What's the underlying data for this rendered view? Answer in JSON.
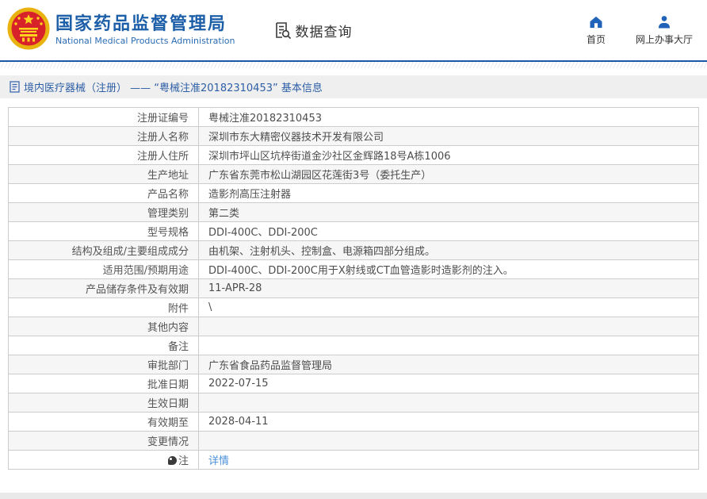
{
  "header": {
    "org_name_zh": "国家药品监督管理局",
    "org_name_en": "National Medical Products Administration",
    "nav_data_query": "数据查询",
    "nav_home": "首页",
    "nav_service_hall": "网上办事大厅",
    "icons": {
      "emblem": "china-national-emblem",
      "data_query": "document-search-icon",
      "home": "home-icon",
      "service_hall": "person-icon"
    }
  },
  "page": {
    "title": "境内医疗器械（注册） —— “粤械注准20182310453” 基本信息",
    "title_icon": "document-icon"
  },
  "table": {
    "rows": [
      {
        "label": "注册证编号",
        "value": "粤械注准20182310453"
      },
      {
        "label": "注册人名称",
        "value": "深圳市东大精密仪器技术开发有限公司"
      },
      {
        "label": "注册人住所",
        "value": "深圳市坪山区坑梓街道金沙社区金辉路18号A栋1006"
      },
      {
        "label": "生产地址",
        "value": "广东省东莞市松山湖园区花莲街3号（委托生产）"
      },
      {
        "label": "产品名称",
        "value": "造影剂高压注射器"
      },
      {
        "label": "管理类别",
        "value": "第二类"
      },
      {
        "label": "型号规格",
        "value": "DDI-400C、DDI-200C"
      },
      {
        "label": "结构及组成/主要组成成分",
        "value": "由机架、注射机头、控制盒、电源箱四部分组成。"
      },
      {
        "label": "适用范围/预期用途",
        "value": "DDI-400C、DDI-200C用于X射线或CT血管造影时造影剂的注入。"
      },
      {
        "label": "产品储存条件及有效期",
        "value": "11-APR-28"
      },
      {
        "label": "附件",
        "value": "\\"
      },
      {
        "label": "其他内容",
        "value": ""
      },
      {
        "label": "备注",
        "value": ""
      },
      {
        "label": "审批部门",
        "value": "广东省食品药品监督管理局"
      },
      {
        "label": "批准日期",
        "value": "2022-07-15"
      },
      {
        "label": "生效日期",
        "value": ""
      },
      {
        "label": "有效期至",
        "value": "2028-04-11"
      },
      {
        "label": "变更情况",
        "value": ""
      },
      {
        "label": "注",
        "value": "详情",
        "link": true,
        "icon": "note-pin-icon"
      }
    ]
  },
  "colors": {
    "brand_blue": "#1c5fa8",
    "icon_blue": "#1f62b8",
    "link_blue": "#4a90d9",
    "title_bar_bg": "#efefef",
    "row_alt_bg": "#f6f6f6",
    "border": "#cccccc",
    "emblem_red": "#d8222a",
    "emblem_gold": "#e8b30e"
  }
}
